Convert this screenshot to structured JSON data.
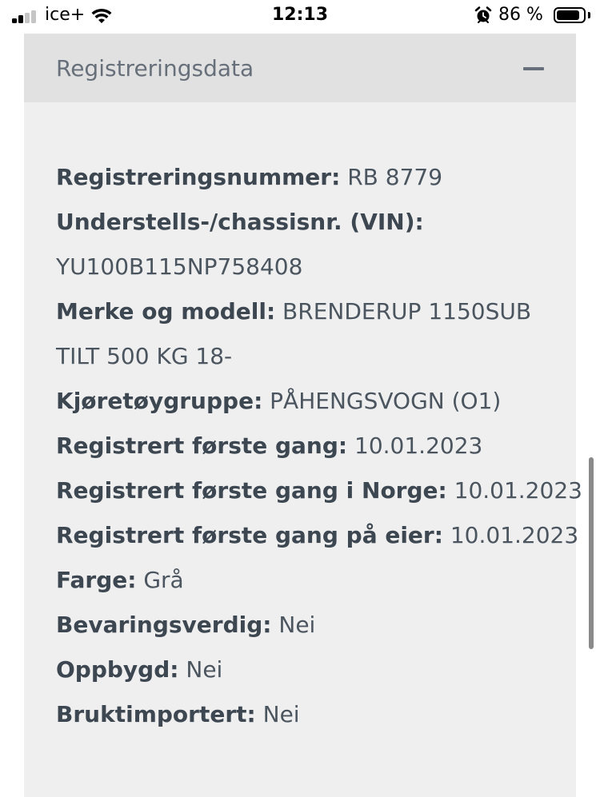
{
  "status_bar": {
    "carrier": "ice+",
    "time": "12:13",
    "battery_percent": "86 %",
    "battery_level": 0.86
  },
  "panel": {
    "title": "Registreringsdata",
    "collapse_icon": "minus-icon"
  },
  "details": {
    "reg_number": {
      "label": "Registreringsnummer:",
      "value": "RB 8779"
    },
    "vin": {
      "label": "Understells-/chassisnr. (VIN):",
      "value": "YU100B115NP758408"
    },
    "model": {
      "label": "Merke og modell:",
      "value_line1": "BRENDERUP 1150SUB",
      "value_line2": "TILT 500 KG 18-"
    },
    "vehicle_group": {
      "label": "Kjøretøygruppe:",
      "value": "PÅHENGSVOGN (O1)"
    },
    "first_registered": {
      "label": "Registrert første gang:",
      "value": "10.01.2023"
    },
    "first_registered_norway": {
      "label": "Registrert første gang i Norge:",
      "value": "10.01.2023"
    },
    "first_registered_owner": {
      "label": "Registrert første gang på eier:",
      "value": "10.01.2023"
    },
    "color": {
      "label": "Farge:",
      "value": "Grå"
    },
    "preservation": {
      "label": "Bevaringsverdig:",
      "value": "Nei"
    },
    "rebuilt": {
      "label": "Oppbygd:",
      "value": "Nei"
    },
    "used_import": {
      "label": "Bruktimportert:",
      "value": "Nei"
    }
  }
}
